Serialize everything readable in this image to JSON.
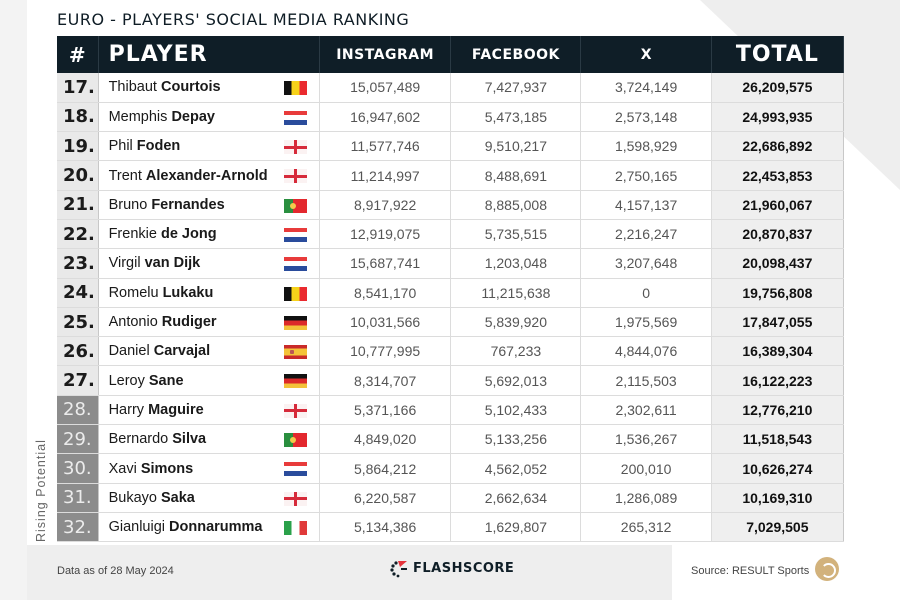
{
  "title": "Euro - Players' Social Media Ranking",
  "columns": {
    "rank": "#",
    "player": "Player",
    "instagram": "Instagram",
    "facebook": "Facebook",
    "x": "X",
    "total": "Total"
  },
  "rows": [
    {
      "rank": "17.",
      "first": "Thibaut",
      "last": "Courtois",
      "flag": "belgium",
      "instagram": "15,057,489",
      "facebook": "7,427,937",
      "x": "3,724,149",
      "total": "26,209,575",
      "rising": false
    },
    {
      "rank": "18.",
      "first": "Memphis",
      "last": "Depay",
      "flag": "netherlands",
      "instagram": "16,947,602",
      "facebook": "5,473,185",
      "x": "2,573,148",
      "total": "24,993,935",
      "rising": false
    },
    {
      "rank": "19.",
      "first": "Phil",
      "last": "Foden",
      "flag": "england",
      "instagram": "11,577,746",
      "facebook": "9,510,217",
      "x": "1,598,929",
      "total": "22,686,892",
      "rising": false
    },
    {
      "rank": "20.",
      "first": "Trent",
      "last": "Alexander-Arnold",
      "flag": "england",
      "instagram": "11,214,997",
      "facebook": "8,488,691",
      "x": "2,750,165",
      "total": "22,453,853",
      "rising": false
    },
    {
      "rank": "21.",
      "first": "Bruno",
      "last": "Fernandes",
      "flag": "portugal",
      "instagram": "8,917,922",
      "facebook": "8,885,008",
      "x": "4,157,137",
      "total": "21,960,067",
      "rising": false
    },
    {
      "rank": "22.",
      "first": "Frenkie",
      "last": "de Jong",
      "flag": "netherlands",
      "instagram": "12,919,075",
      "facebook": "5,735,515",
      "x": "2,216,247",
      "total": "20,870,837",
      "rising": false
    },
    {
      "rank": "23.",
      "first": "Virgil",
      "last": "van Dijk",
      "flag": "netherlands",
      "instagram": "15,687,741",
      "facebook": "1,203,048",
      "x": "3,207,648",
      "total": "20,098,437",
      "rising": false
    },
    {
      "rank": "24.",
      "first": "Romelu",
      "last": "Lukaku",
      "flag": "belgium",
      "instagram": "8,541,170",
      "facebook": "11,215,638",
      "x": "0",
      "total": "19,756,808",
      "rising": false
    },
    {
      "rank": "25.",
      "first": "Antonio",
      "last": "Rudiger",
      "flag": "germany",
      "instagram": "10,031,566",
      "facebook": "5,839,920",
      "x": "1,975,569",
      "total": "17,847,055",
      "rising": false
    },
    {
      "rank": "26.",
      "first": "Daniel",
      "last": "Carvajal",
      "flag": "spain",
      "instagram": "10,777,995",
      "facebook": "767,233",
      "x": "4,844,076",
      "total": "16,389,304",
      "rising": false
    },
    {
      "rank": "27.",
      "first": "Leroy",
      "last": "Sane",
      "flag": "germany",
      "instagram": "8,314,707",
      "facebook": "5,692,013",
      "x": "2,115,503",
      "total": "16,122,223",
      "rising": false
    },
    {
      "rank": "28.",
      "first": "Harry",
      "last": "Maguire",
      "flag": "england",
      "instagram": "5,371,166",
      "facebook": "5,102,433",
      "x": "2,302,611",
      "total": "12,776,210",
      "rising": true
    },
    {
      "rank": "29.",
      "first": "Bernardo",
      "last": "Silva",
      "flag": "portugal",
      "instagram": "4,849,020",
      "facebook": "5,133,256",
      "x": "1,536,267",
      "total": "11,518,543",
      "rising": true
    },
    {
      "rank": "30.",
      "first": "Xavi",
      "last": "Simons",
      "flag": "netherlands",
      "instagram": "5,864,212",
      "facebook": "4,562,052",
      "x": "200,010",
      "total": "10,626,274",
      "rising": true
    },
    {
      "rank": "31.",
      "first": "Bukayo",
      "last": "Saka",
      "flag": "england",
      "instagram": "6,220,587",
      "facebook": "2,662,634",
      "x": "1,286,089",
      "total": "10,169,310",
      "rising": true
    },
    {
      "rank": "32.",
      "first": "Gianluigi",
      "last": "Donnarumma",
      "flag": "italy",
      "instagram": "5,134,386",
      "facebook": "1,629,807",
      "x": "265,312",
      "total": "7,029,505",
      "rising": true
    }
  ],
  "rising_label": "Rising Potential",
  "footer": {
    "date_note": "Data as of 28 May 2024",
    "brand": "FLASHSCORE",
    "source": "Source: RESULT Sports"
  },
  "colors": {
    "header_bg": "#0f1e27",
    "rising_rank_bg": "#8c8c8c",
    "rank_bg": "#e9e9e9",
    "total_bg": "#efefef",
    "brand_red": "#e5343c"
  }
}
